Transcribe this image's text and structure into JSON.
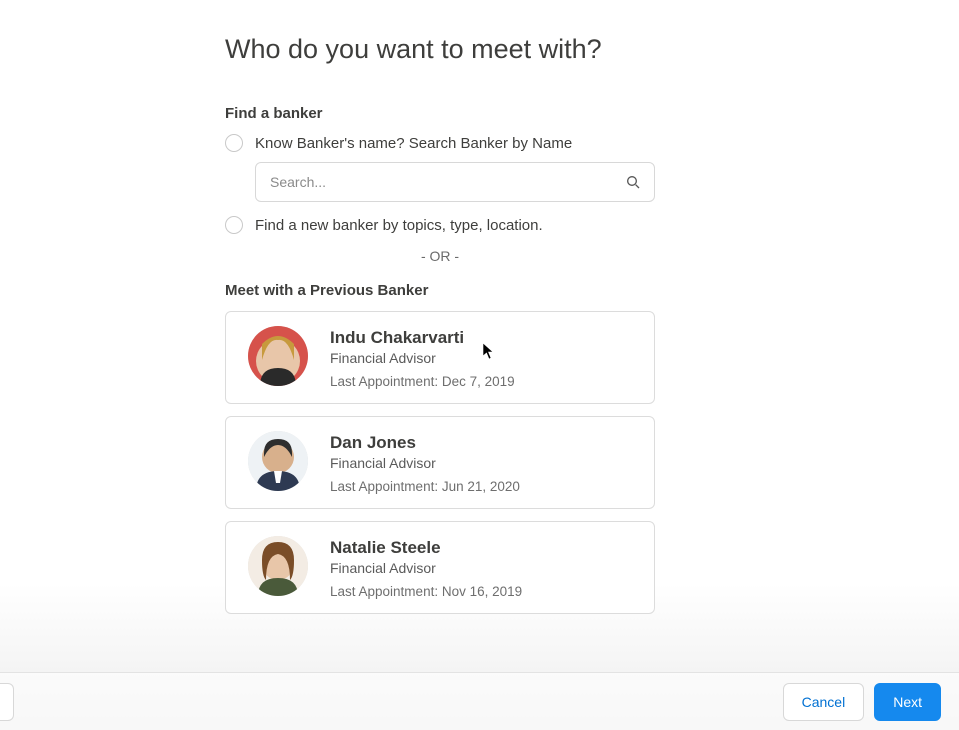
{
  "heading": "Who do you want to meet with?",
  "find_section": {
    "label": "Find a banker",
    "option_search_label": "Know Banker's name? Search Banker by Name",
    "option_filter_label": "Find a new banker by topics, type, location.",
    "search_placeholder": "Search..."
  },
  "or_text": "- OR -",
  "previous_section": {
    "label": "Meet with a Previous Banker",
    "bankers": [
      {
        "name": "Indu Chakarvarti",
        "title": "Financial Advisor",
        "last": "Last Appointment: Dec 7, 2019"
      },
      {
        "name": "Dan Jones",
        "title": "Financial Advisor",
        "last": "Last Appointment: Jun 21, 2020"
      },
      {
        "name": "Natalie Steele",
        "title": "Financial Advisor",
        "last": "Last Appointment: Nov 16, 2019"
      }
    ]
  },
  "footer": {
    "cancel": "Cancel",
    "next": "Next"
  }
}
